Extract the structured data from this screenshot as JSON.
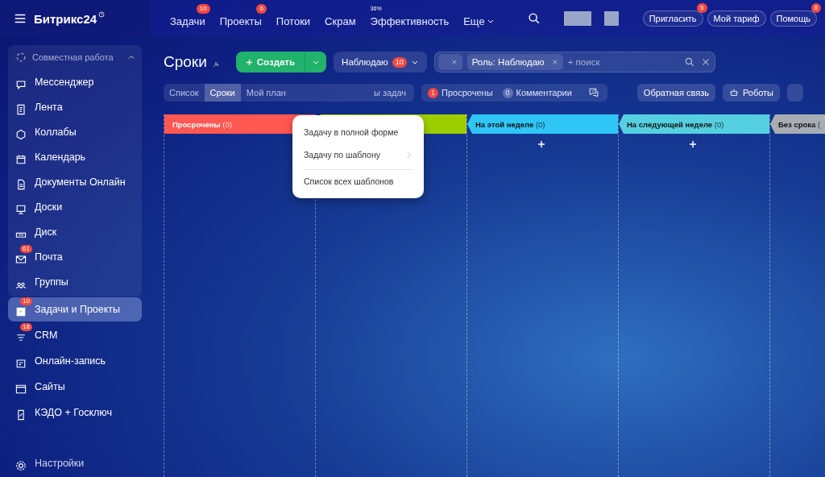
{
  "topbar": {
    "logo": "Битрикс24",
    "nav": [
      {
        "label": "Задачи",
        "badge": "10",
        "dropdown": false
      },
      {
        "label": "Проекты",
        "badge": "6",
        "dropdown": false
      },
      {
        "label": "Потоки",
        "dropdown": false
      },
      {
        "label": "Скрам",
        "dropdown": false
      },
      {
        "label": "Эффективность",
        "note": "36%",
        "dropdown": false
      },
      {
        "label": "Еще",
        "dropdown": true
      }
    ],
    "buttons": [
      {
        "label": "Пригласить",
        "badge": "5"
      },
      {
        "label": "Мой тариф"
      },
      {
        "label": "Помощь",
        "badge": "8"
      }
    ]
  },
  "sidebar": {
    "group": {
      "label": "Совместная работа",
      "expanded": true
    },
    "items": [
      {
        "label": "Мессенджер",
        "selected": false
      },
      {
        "label": "Лента",
        "selected": false
      },
      {
        "label": "Коллабы",
        "selected": false
      },
      {
        "label": "Календарь",
        "selected": false
      },
      {
        "label": "Документы Онлайн",
        "selected": false
      },
      {
        "label": "Доски",
        "selected": false
      },
      {
        "label": "Диск",
        "selected": false
      },
      {
        "label": "Почта",
        "badge": "61",
        "selected": false
      },
      {
        "label": "Группы",
        "selected": false
      }
    ],
    "bottom_items": [
      {
        "label": "Задачи и Проекты",
        "badge": "10",
        "selected": true
      },
      {
        "label": "CRM",
        "badge": "18",
        "selected": false
      },
      {
        "label": "Онлайн-запись",
        "selected": false
      },
      {
        "label": "Сайты",
        "selected": false
      },
      {
        "label": "КЭДО + Госключ",
        "selected": false
      }
    ],
    "settings": "Настройки"
  },
  "page": {
    "title": "Сроки",
    "create_button": "Создать",
    "role_filter": {
      "label": "Наблюдаю",
      "badge": "10"
    },
    "search": {
      "tags": [
        {
          "kind": "blank"
        },
        {
          "kind": "role",
          "label": "Роль: Наблюдаю"
        }
      ],
      "placeholder": "+ поиск"
    },
    "views": [
      {
        "label": "Список",
        "selected": false
      },
      {
        "label": "Сроки",
        "selected": true
      },
      {
        "label": "Мой план",
        "selected": false
      },
      {
        "label": "ы задач",
        "selected": false
      }
    ],
    "counters": [
      {
        "count": "1",
        "label": "Просрочены",
        "kind": "alert"
      },
      {
        "count": "0",
        "label": "Комментарии",
        "kind": "muted"
      }
    ],
    "actions": [
      "Обратная связь",
      "Роботы"
    ],
    "columns": [
      {
        "title": "Просрочены",
        "count": "(0)",
        "color": "#ff5752",
        "add": false
      },
      {
        "color": "#9dcf00"
      },
      {
        "title": "На этой неделе",
        "count": "(0)",
        "color": "#2fc6f6",
        "add": true
      },
      {
        "title": "На следующей неделе",
        "count": "(0)",
        "color": "#55d0e0",
        "add": true
      },
      {
        "title": "Без срока",
        "count": "(",
        "color": "#a8adb4"
      }
    ]
  },
  "create_menu": {
    "items": [
      {
        "label": "Задачу в полной форме",
        "has_submenu": false,
        "separated": false
      },
      {
        "label": "Задачу по шаблону",
        "has_submenu": true,
        "separated": false
      },
      {
        "label": "Список всех шаблонов",
        "has_submenu": false,
        "separated": true
      }
    ]
  }
}
